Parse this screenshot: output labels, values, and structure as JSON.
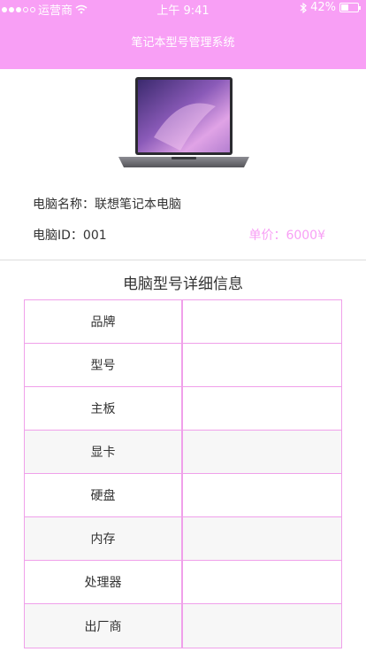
{
  "status_bar": {
    "carrier": "运营商",
    "time": "上午 9:41",
    "battery": "42%",
    "battery_level": 0.42
  },
  "header": {
    "title": "笔记本型号管理系统"
  },
  "product": {
    "name_line": "电脑名称：联想笔记本电脑",
    "id_line": "电脑ID：001",
    "price_line": "单价：6000¥"
  },
  "details": {
    "title": "电脑型号详细信息",
    "rows": [
      {
        "label": "品牌",
        "value": ""
      },
      {
        "label": "型号",
        "value": ""
      },
      {
        "label": "主板",
        "value": ""
      },
      {
        "label": "显卡",
        "value": ""
      },
      {
        "label": "硬盘",
        "value": ""
      },
      {
        "label": "内存",
        "value": ""
      },
      {
        "label": "处理器",
        "value": ""
      },
      {
        "label": "出厂商",
        "value": ""
      }
    ]
  },
  "colors": {
    "accent": "#f89ff5",
    "border": "#f0a0ea"
  },
  "icons": [
    "signal-dots-icon",
    "wifi-icon",
    "bluetooth-icon",
    "battery-icon",
    "laptop-image"
  ]
}
